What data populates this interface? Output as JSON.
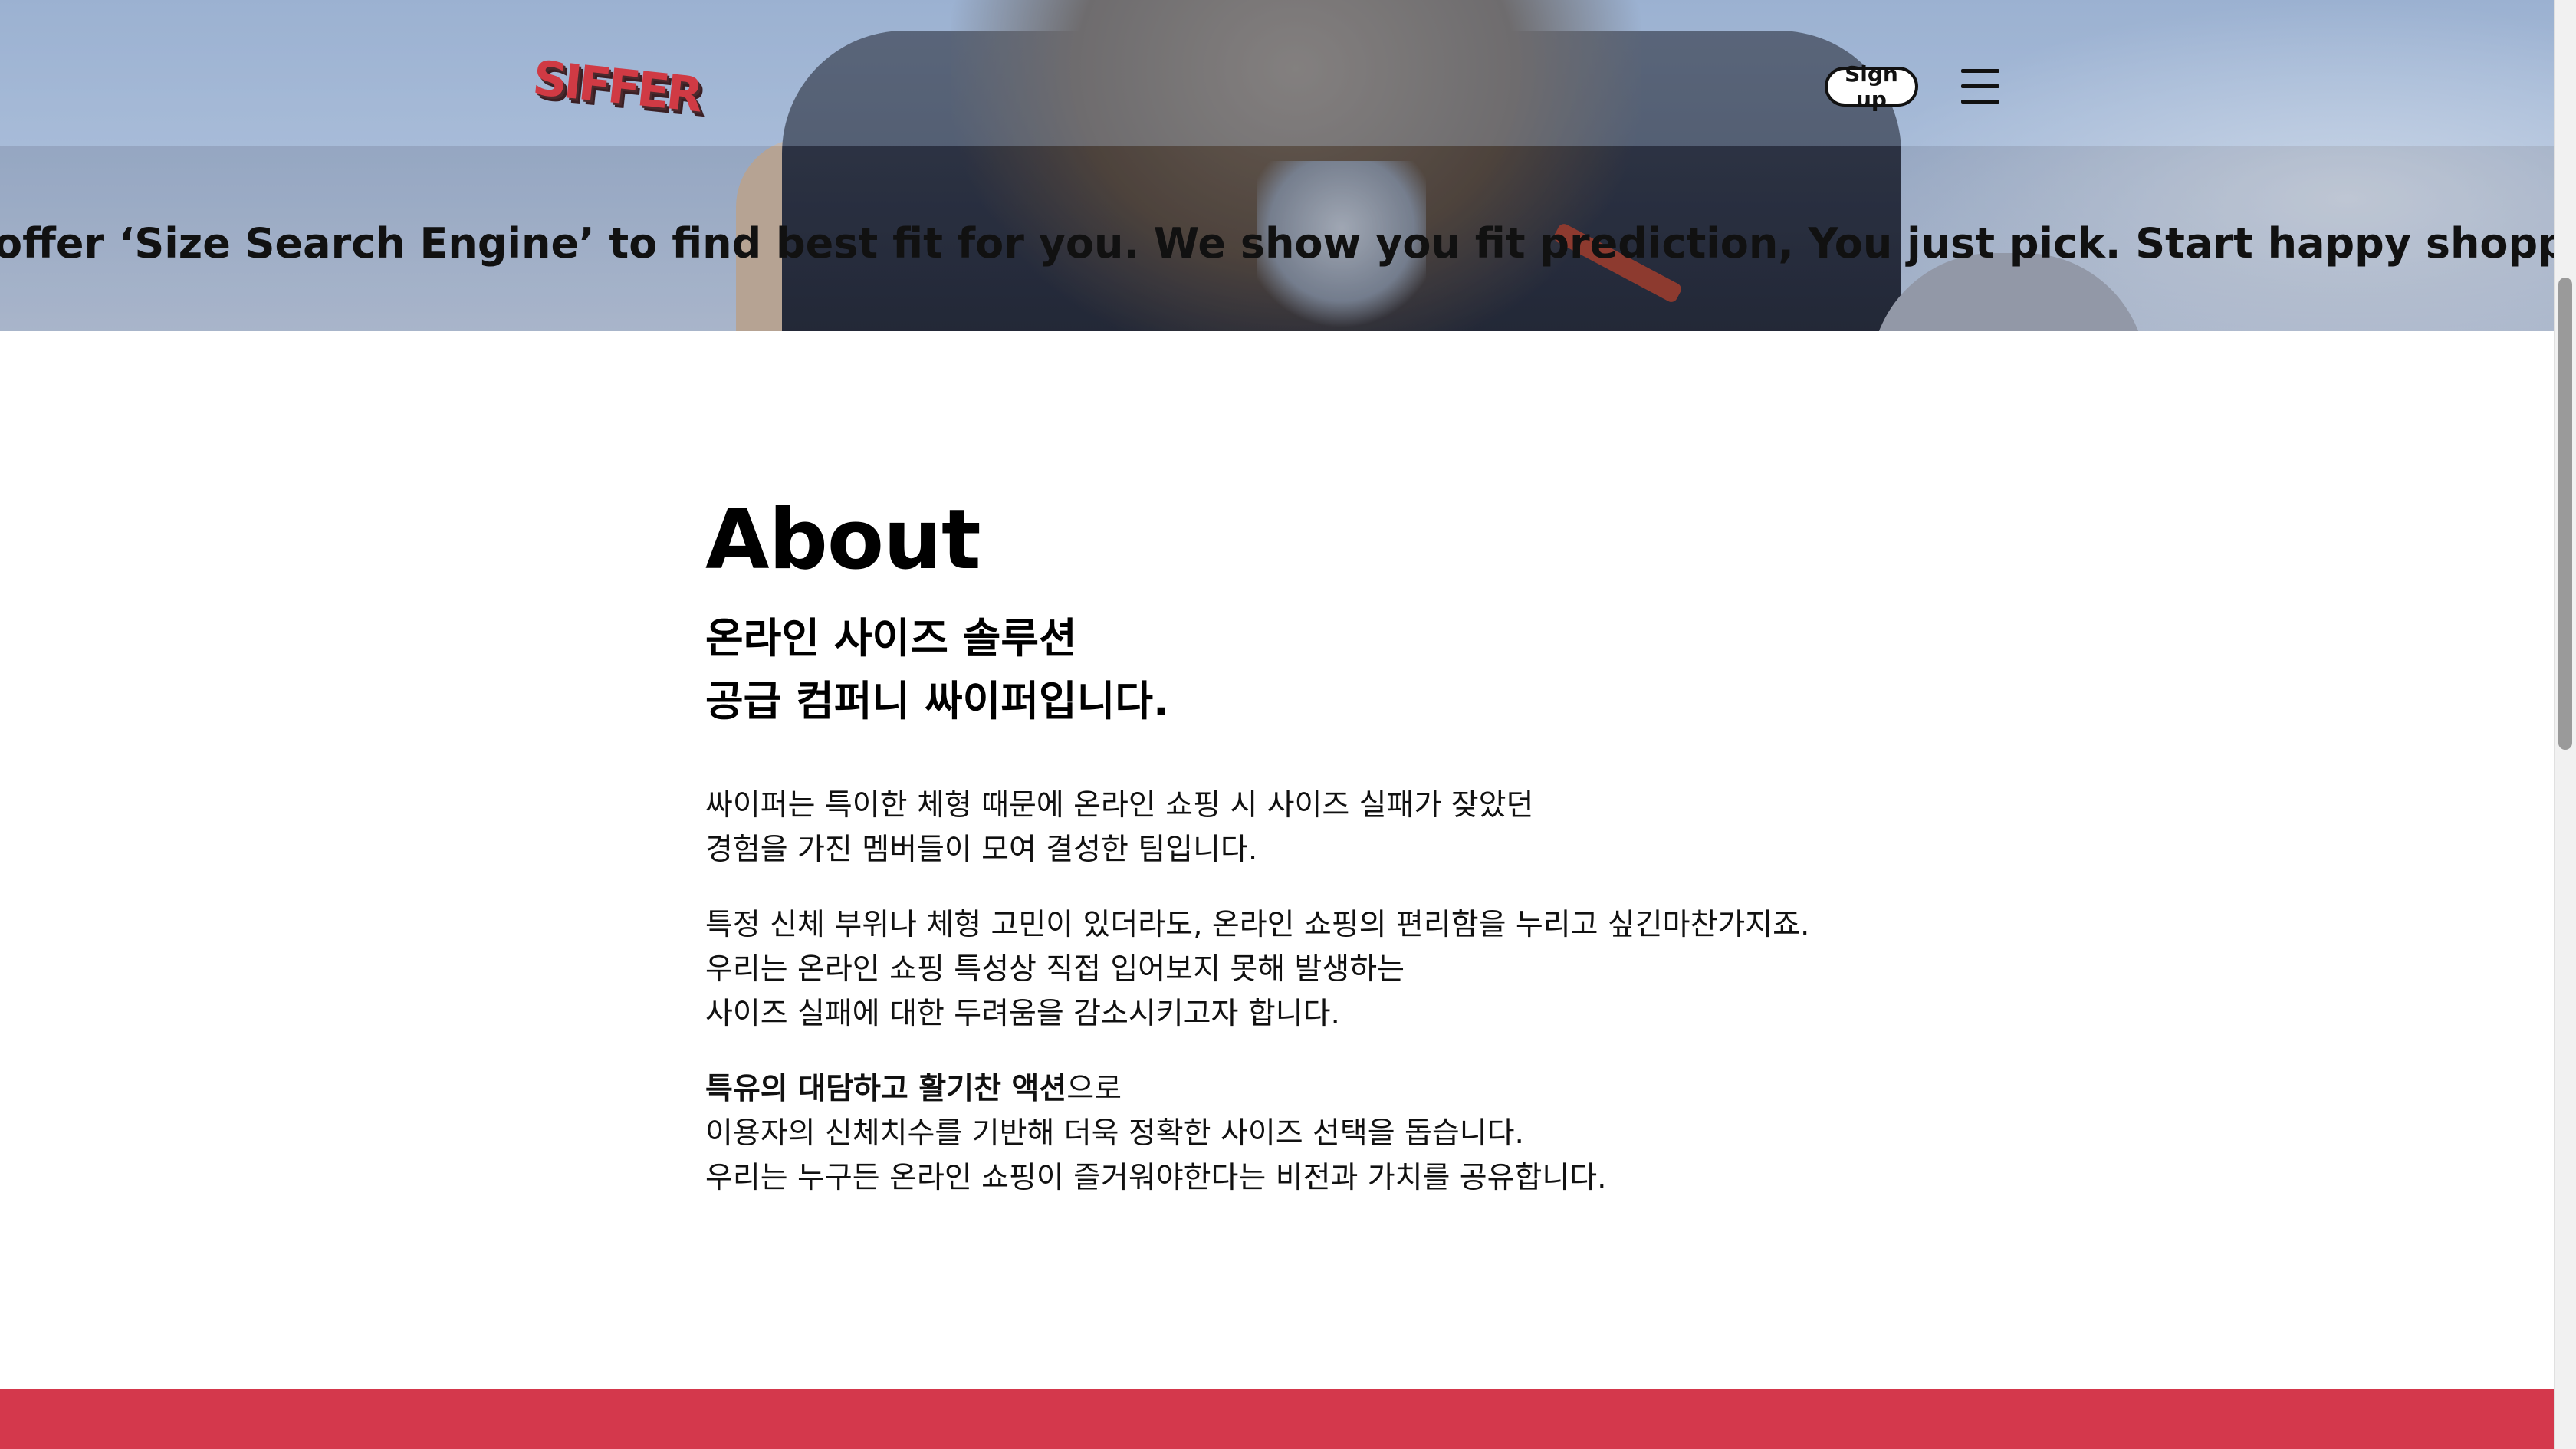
{
  "header": {
    "logo_text": "SIFFER",
    "signup_label": "Sign up",
    "menu_icon": "hamburger-menu-icon"
  },
  "ticker": {
    "text": "offer ‘Size Search Engine’ to find best fit for you. We show you fit prediction, You just pick. Start happy shopping with SIFFER. Welco"
  },
  "about": {
    "title": "About",
    "subtitle_lines": [
      "온라인 사이즈 솔루션",
      "공급 컴퍼니 싸이퍼입니다."
    ],
    "para1_lines": [
      "싸이퍼는 특이한 체형 때문에 온라인 쇼핑 시 사이즈 실패가 잦았던",
      "경험을 가진 멤버들이 모여 결성한 팀입니다."
    ],
    "para2_lines": [
      "특정 신체 부위나 체형 고민이 있더라도, 온라인 쇼핑의 편리함을 누리고 싶긴마찬가지죠.",
      "우리는 온라인 쇼핑 특성상 직접 입어보지 못해 발생하는",
      "사이즈 실패에 대한 두려움을 감소시키고자 합니다."
    ],
    "para3_bold": "특유의 대담하고 활기찬 액션",
    "para3_bold_suffix": "으로",
    "para3_lines": [
      "이용자의 신체치수를 기반해 더욱 정확한 사이즈 선택을 돕습니다.",
      "우리는 누구든 온라인 쇼핑이 즐거워야한다는 비전과 가치를 공유합니다."
    ]
  },
  "colors": {
    "accent": "#d4384c",
    "hero_sky": "#b6c9e3"
  }
}
